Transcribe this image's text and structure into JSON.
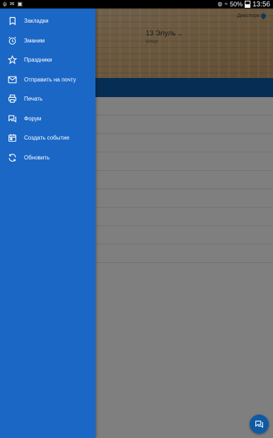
{
  "status_bar": {
    "battery": "50%",
    "time": "13:56"
  },
  "drawer": {
    "items": [
      {
        "label": "Закладки",
        "icon": "bookmark-icon"
      },
      {
        "label": "Зманим",
        "icon": "alarm-clock-icon"
      },
      {
        "label": "Праздники",
        "icon": "star-icon"
      },
      {
        "label": "Отправить на почту",
        "icon": "mail-icon"
      },
      {
        "label": "Печать",
        "icon": "printer-icon"
      },
      {
        "label": "Форум",
        "icon": "forum-icon"
      },
      {
        "label": "Создать событие",
        "icon": "calendar-icon"
      },
      {
        "label": "Обновить",
        "icon": "refresh-icon"
      }
    ]
  },
  "background": {
    "date": "13 Элуль",
    "subtitle": "Шищи",
    "location": "Диаспора"
  },
  "colors": {
    "drawer": "#1a67c6",
    "header_bar": "#0d5da8",
    "fab": "#0e5aa3"
  }
}
